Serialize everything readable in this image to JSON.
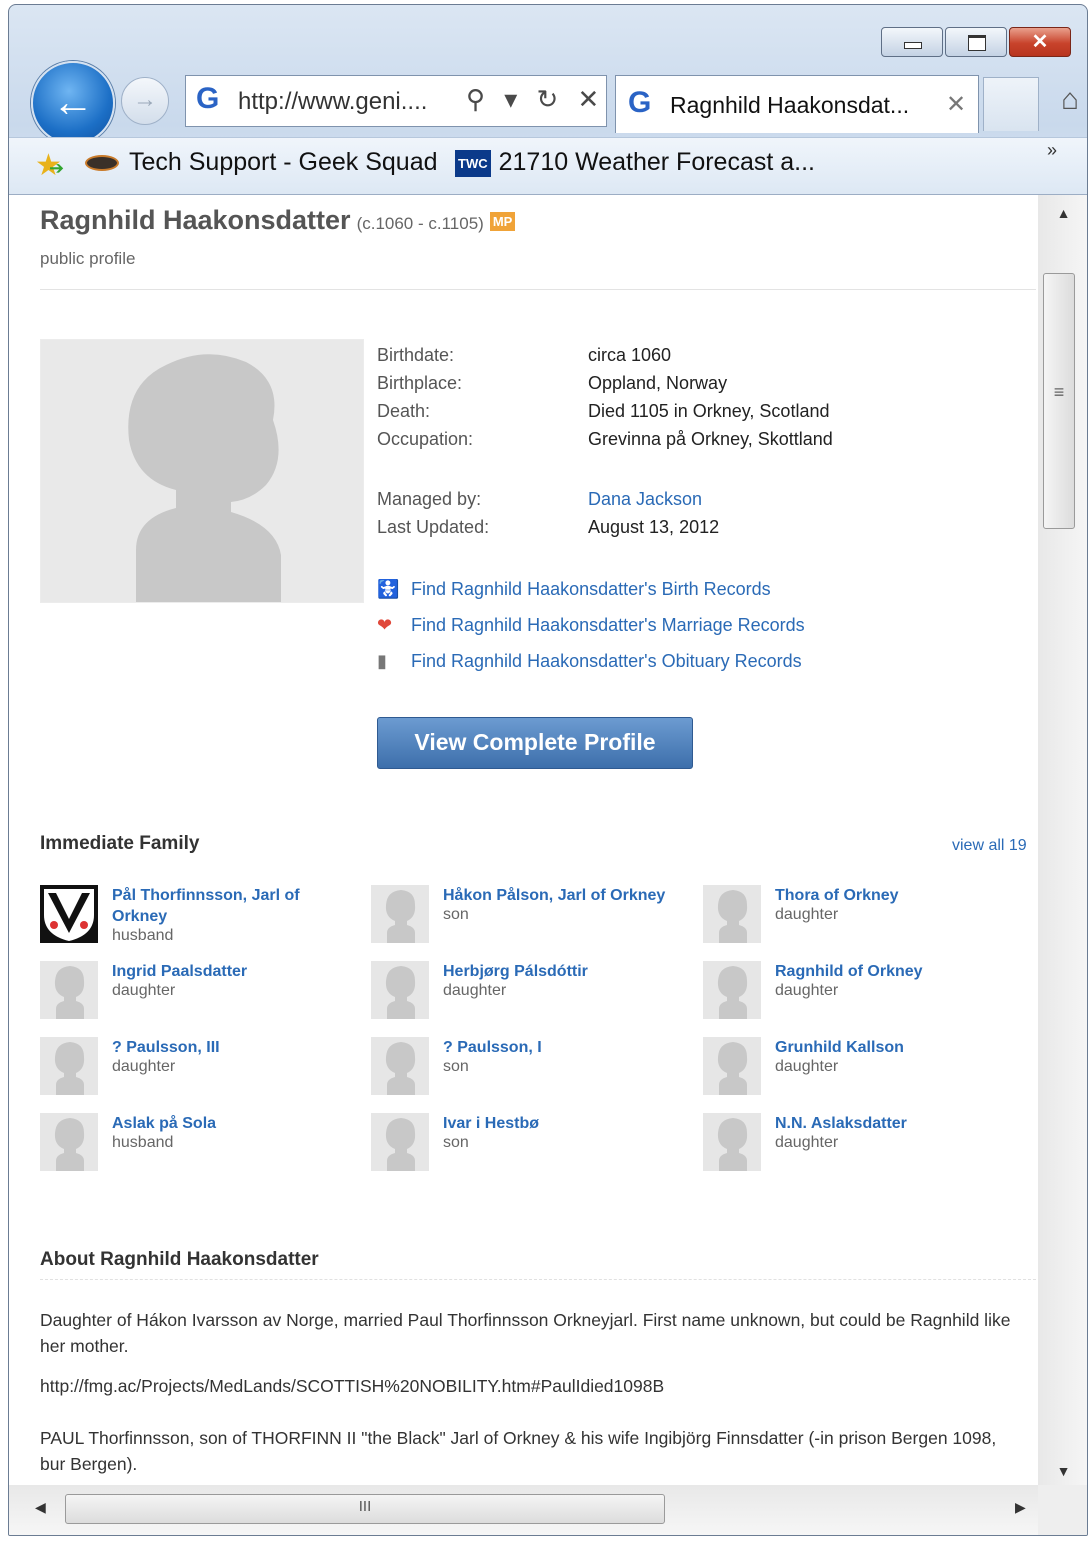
{
  "browser": {
    "address": "http://www.geni....",
    "address_icons": "⚲ ▾ ↻ ✕",
    "tab_title": "Ragnhild Haakonsdat...",
    "favorites": [
      {
        "label": "Tech Support - Geek Squad"
      },
      {
        "label": "21710 Weather Forecast a...",
        "badge": "TWC"
      }
    ],
    "chevron": "»",
    "close_glyph": "✕",
    "back_glyph": "←",
    "fwd_glyph": "→",
    "home_glyph": "⌂",
    "hscroll_grip": "III"
  },
  "profile": {
    "name": "Ragnhild Haakonsdatter",
    "dates": "(c.1060 - c.1105)",
    "badge": "MP",
    "subtitle": "public profile",
    "facts": [
      {
        "label": "Birthdate:",
        "value": "circa 1060"
      },
      {
        "label": "Birthplace:",
        "value": "Oppland, Norway"
      },
      {
        "label": "Death:",
        "value": "Died 1105 in Orkney, Scotland"
      },
      {
        "label": "Occupation:",
        "value": "Grevinna på Orkney, Skottland"
      }
    ],
    "managed_by_label": "Managed by:",
    "managed_by": "Dana Jackson",
    "updated_label": "Last Updated:",
    "updated": "August 13, 2012",
    "records": [
      {
        "icon": "baby-carriage-icon",
        "glyph": "🚼",
        "label": "Find Ragnhild Haakonsdatter's Birth Records"
      },
      {
        "icon": "heart-icon",
        "glyph": "❤",
        "label": "Find Ragnhild Haakonsdatter's Marriage Records"
      },
      {
        "icon": "tombstone-icon",
        "glyph": "▮",
        "label": "Find Ragnhild Haakonsdatter's Obituary Records"
      }
    ],
    "cta": "View Complete Profile"
  },
  "family": {
    "heading": "Immediate Family",
    "view_all": "view all 19",
    "members": [
      {
        "name": "Pål Thorfinnsson, Jarl of Orkney",
        "role": "husband"
      },
      {
        "name": "Håkon Pålson, Jarl of Orkney",
        "role": "son"
      },
      {
        "name": "Thora of Orkney",
        "role": "daughter"
      },
      {
        "name": "Ingrid Paalsdatter",
        "role": "daughter"
      },
      {
        "name": "Herbjørg Pálsdóttir",
        "role": "daughter"
      },
      {
        "name": "Ragnhild of Orkney",
        "role": "daughter"
      },
      {
        "name": "? Paulsson, III",
        "role": "daughter"
      },
      {
        "name": "? Paulsson, I",
        "role": "son"
      },
      {
        "name": "Grunhild Kallson",
        "role": "daughter"
      },
      {
        "name": "Aslak på Sola",
        "role": "husband"
      },
      {
        "name": "Ivar i Hestbø",
        "role": "son"
      },
      {
        "name": "N.N. Aslaksdatter",
        "role": "daughter"
      }
    ]
  },
  "about": {
    "heading": "About Ragnhild Haakonsdatter",
    "p1": "Daughter of Hákon Ivarsson av Norge, married Paul Thorfinnsson Orkneyjarl. First name unknown, but could be Ragnhild like her mother.",
    "link": "http://fmg.ac/Projects/MedLands/SCOTTISH%20NOBILITY.htm#PaulIdied1098B",
    "p2": "PAUL Thorfinnsson, son of THORFINN II \"the Black\" Jarl of Orkney & his wife Ingibjörg Finnsdatter (-in prison Bergen 1098, bur Bergen)."
  },
  "colors": {
    "link": "#2a6ab6",
    "cta": "#4a7ab8",
    "badge": "#f0a338",
    "close": "#c8432b"
  }
}
